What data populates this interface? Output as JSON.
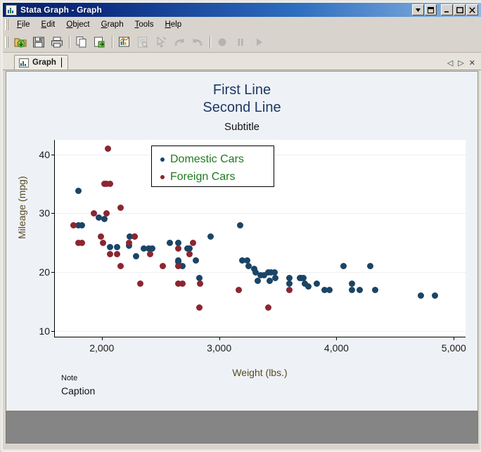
{
  "window": {
    "title": "Stata Graph - Graph",
    "title_icon": "graph-icon",
    "controls": [
      {
        "name": "window-dropdown-button",
        "glyph": "▼"
      },
      {
        "name": "window-restore-button",
        "glyph": "❐"
      },
      {
        "name": "window-minimize-button",
        "glyph": "_"
      },
      {
        "name": "window-maximize-button",
        "glyph": "☐"
      },
      {
        "name": "window-close-button",
        "glyph": "✕"
      }
    ]
  },
  "menubar": {
    "items": [
      {
        "label": "File",
        "mnemonic": "F"
      },
      {
        "label": "Edit",
        "mnemonic": "E"
      },
      {
        "label": "Object",
        "mnemonic": "O"
      },
      {
        "label": "Graph",
        "mnemonic": "G"
      },
      {
        "label": "Tools",
        "mnemonic": "T"
      },
      {
        "label": "Help",
        "mnemonic": "H"
      }
    ]
  },
  "toolbar": {
    "items": [
      {
        "name": "open-button",
        "icon": "folder-open-icon",
        "enabled": true
      },
      {
        "name": "save-button",
        "icon": "floppy-disk-icon",
        "enabled": true
      },
      {
        "name": "print-button",
        "icon": "printer-icon",
        "enabled": true
      },
      {
        "name": "copy-button",
        "icon": "copy-icon",
        "enabled": true
      },
      {
        "name": "paste-button",
        "icon": "paste-icon",
        "enabled": true
      },
      {
        "name": "start-graph-editor-button",
        "icon": "graph-editor-icon",
        "enabled": true
      },
      {
        "name": "grid-edit-button",
        "icon": "grid-edit-icon",
        "enabled": false
      },
      {
        "name": "pointer-tool-button",
        "icon": "pointer-icon",
        "enabled": false
      },
      {
        "name": "redo-button",
        "icon": "redo-arrow-icon",
        "enabled": false
      },
      {
        "name": "undo-button",
        "icon": "undo-arrow-icon",
        "enabled": false
      },
      {
        "name": "record-button",
        "icon": "record-circle-icon",
        "enabled": false
      },
      {
        "name": "pause-button",
        "icon": "pause-icon",
        "enabled": false
      },
      {
        "name": "play-button",
        "icon": "play-triangle-icon",
        "enabled": false
      }
    ]
  },
  "tabstrip": {
    "tabs": [
      {
        "label": "Graph",
        "icon": "graph-icon",
        "active": true
      }
    ],
    "nav": {
      "prev": "◁",
      "next": "▷",
      "close": "✕"
    }
  },
  "chart_data": {
    "type": "scatter",
    "title": "First Line\nSecond Line",
    "title_line1": "First Line",
    "title_line2": "Second Line",
    "subtitle": "Subtitle",
    "note": "Note",
    "caption": "Caption",
    "xlabel": "Weight (lbs.)",
    "ylabel": "Mileage (mpg)",
    "xlim": [
      1600,
      5100
    ],
    "ylim": [
      9,
      42.5
    ],
    "xticks": [
      2000,
      3000,
      4000,
      5000
    ],
    "xticklabels": [
      "2,000",
      "3,000",
      "4,000",
      "5,000"
    ],
    "yticks": [
      10,
      20,
      30,
      40
    ],
    "yticklabels": [
      "10",
      "20",
      "30",
      "40"
    ],
    "grid": "horizontal",
    "legend_position": "upper center inside",
    "colors": {
      "domestic": "#1a4566",
      "foreign": "#8b2631",
      "title": "#1f3864",
      "legend_text": "#1f7a1f",
      "axis_title": "#59491f",
      "plot_background": "#ffffff",
      "canvas_background": "#eef2f7",
      "gridline": "#eceff1"
    },
    "series": [
      {
        "name": "Domestic Cars",
        "color": "#1a4566",
        "points": [
          [
            1800,
            33.8
          ],
          [
            1800,
            28.0
          ],
          [
            1830,
            28.0
          ],
          [
            1975,
            29.3
          ],
          [
            2020,
            29.0
          ],
          [
            2240,
            26.0
          ],
          [
            2280,
            26.0
          ],
          [
            2230,
            24.5
          ],
          [
            2070,
            24.2
          ],
          [
            2130,
            24.2
          ],
          [
            2360,
            24.0
          ],
          [
            2400,
            24.0
          ],
          [
            2430,
            24.0
          ],
          [
            2290,
            22.7
          ],
          [
            2650,
            22.0
          ],
          [
            2650,
            21.8
          ],
          [
            2690,
            21.0
          ],
          [
            2730,
            24.0
          ],
          [
            2750,
            24.0
          ],
          [
            2800,
            22.0
          ],
          [
            2830,
            19.0
          ],
          [
            3180,
            28.0
          ],
          [
            3200,
            22.0
          ],
          [
            3240,
            22.0
          ],
          [
            3250,
            21.0
          ],
          [
            3300,
            20.5
          ],
          [
            3310,
            20.0
          ],
          [
            3350,
            19.5
          ],
          [
            3380,
            19.5
          ],
          [
            3420,
            20.0
          ],
          [
            3440,
            20.0
          ],
          [
            3470,
            20.0
          ],
          [
            3480,
            19.0
          ],
          [
            3330,
            18.5
          ],
          [
            3430,
            18.5
          ],
          [
            3600,
            19.0
          ],
          [
            3690,
            19.0
          ],
          [
            3700,
            19.0
          ],
          [
            3720,
            19.0
          ],
          [
            3600,
            18.0
          ],
          [
            3730,
            18.0
          ],
          [
            3760,
            17.5
          ],
          [
            3830,
            18.0
          ],
          [
            3900,
            17.0
          ],
          [
            3940,
            17.0
          ],
          [
            4060,
            21.0
          ],
          [
            4130,
            18.0
          ],
          [
            4130,
            17.0
          ],
          [
            4200,
            17.0
          ],
          [
            4290,
            21.0
          ],
          [
            4330,
            17.0
          ],
          [
            4720,
            16.0
          ],
          [
            4840,
            16.0
          ],
          [
            2930,
            26.0
          ],
          [
            2650,
            25.0
          ],
          [
            2580,
            25.0
          ]
        ]
      },
      {
        "name": "Foreign Cars",
        "color": "#8b2631",
        "points": [
          [
            1760,
            28.0
          ],
          [
            2050,
            41.0
          ],
          [
            2020,
            35.0
          ],
          [
            2040,
            35.0
          ],
          [
            2070,
            35.0
          ],
          [
            1930,
            30.0
          ],
          [
            2160,
            31.0
          ],
          [
            2040,
            30.0
          ],
          [
            1800,
            25.0
          ],
          [
            1830,
            25.0
          ],
          [
            2010,
            25.0
          ],
          [
            1990,
            26.0
          ],
          [
            2230,
            25.0
          ],
          [
            2280,
            26.0
          ],
          [
            2070,
            23.0
          ],
          [
            2130,
            23.0
          ],
          [
            2160,
            21.0
          ],
          [
            2330,
            18.0
          ],
          [
            2750,
            23.0
          ],
          [
            2650,
            24.0
          ],
          [
            2650,
            21.0
          ],
          [
            2690,
            18.0
          ],
          [
            2780,
            25.0
          ],
          [
            2840,
            18.0
          ],
          [
            2830,
            14.0
          ],
          [
            3170,
            17.0
          ],
          [
            3420,
            14.0
          ],
          [
            3600,
            17.0
          ],
          [
            2410,
            23.0
          ],
          [
            2520,
            21.0
          ],
          [
            2650,
            18.0
          ]
        ]
      }
    ]
  }
}
